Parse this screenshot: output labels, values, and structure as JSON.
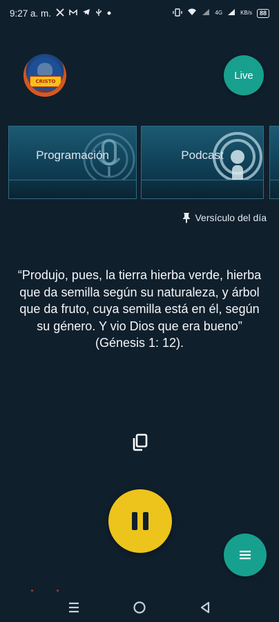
{
  "status_bar": {
    "time": "9:27 a. m.",
    "left_icons": [
      "x-icon",
      "gmail-icon",
      "telegram-icon",
      "usb-icon",
      "dot-icon"
    ],
    "right_icons": [
      "vibrate-icon",
      "wifi-icon",
      "signal-icon",
      "lte-signal-icon"
    ],
    "network_label": "4G",
    "speed_label": "KB/s",
    "battery_level": "88"
  },
  "header": {
    "logo_text": "CRISTO VIENE",
    "live_label": "Live"
  },
  "cards": [
    {
      "label": "Programación",
      "icon": "microphone-icon"
    },
    {
      "label": "Podcast",
      "icon": "podcast-icon"
    }
  ],
  "verse": {
    "header_label": "Versículo del día",
    "header_icon": "pin-icon",
    "text": "“Produjo, pues, la tierra hierba verde, hierba que da semilla según su naturaleza, y árbol que da fruto, cuya semilla está en él, según su género. Y vio Dios que era bueno”",
    "reference": "(Génesis 1: 12)."
  },
  "player": {
    "state": "playing",
    "copy_icon": "copy-icon",
    "play_pause_icon": "pause-icon",
    "menu_icon": "menu-icon"
  },
  "colors": {
    "background": "#101f2c",
    "accent_teal": "#17a08e",
    "accent_yellow": "#ecc41b"
  },
  "nav": {
    "icons": [
      "recents-icon",
      "home-icon",
      "back-icon"
    ]
  }
}
